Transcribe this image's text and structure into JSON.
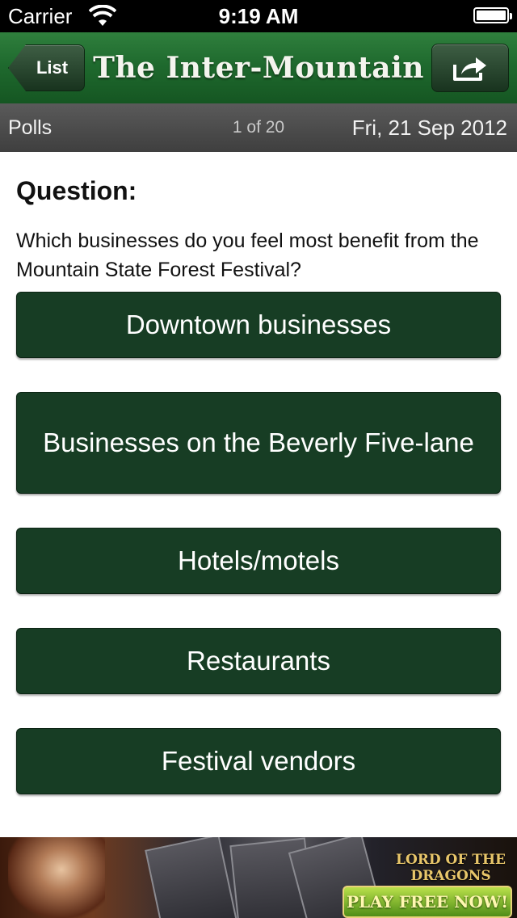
{
  "status_bar": {
    "carrier": "Carrier",
    "time": "9:19 AM"
  },
  "nav": {
    "back_label": "List",
    "title": "The Inter-Mountain",
    "share_icon": "share-icon"
  },
  "subheader": {
    "section": "Polls",
    "pager": "1 of 20",
    "date": "Fri, 21 Sep 2012"
  },
  "poll": {
    "heading": "Question:",
    "question": "Which businesses do you feel most benefit from the Mountain State Forest Festival?",
    "options": [
      "Downtown businesses",
      "Businesses on the Beverly Five-lane",
      "Hotels/motels",
      "Restaurants",
      "Festival vendors"
    ]
  },
  "ad": {
    "logo": "LORD OF THE DRAGONS",
    "cta": "PLAY FREE NOW!"
  },
  "colors": {
    "nav_green": "#1f6a2e",
    "option_green": "#173d24",
    "subbar_gray": "#4a4a4a"
  }
}
